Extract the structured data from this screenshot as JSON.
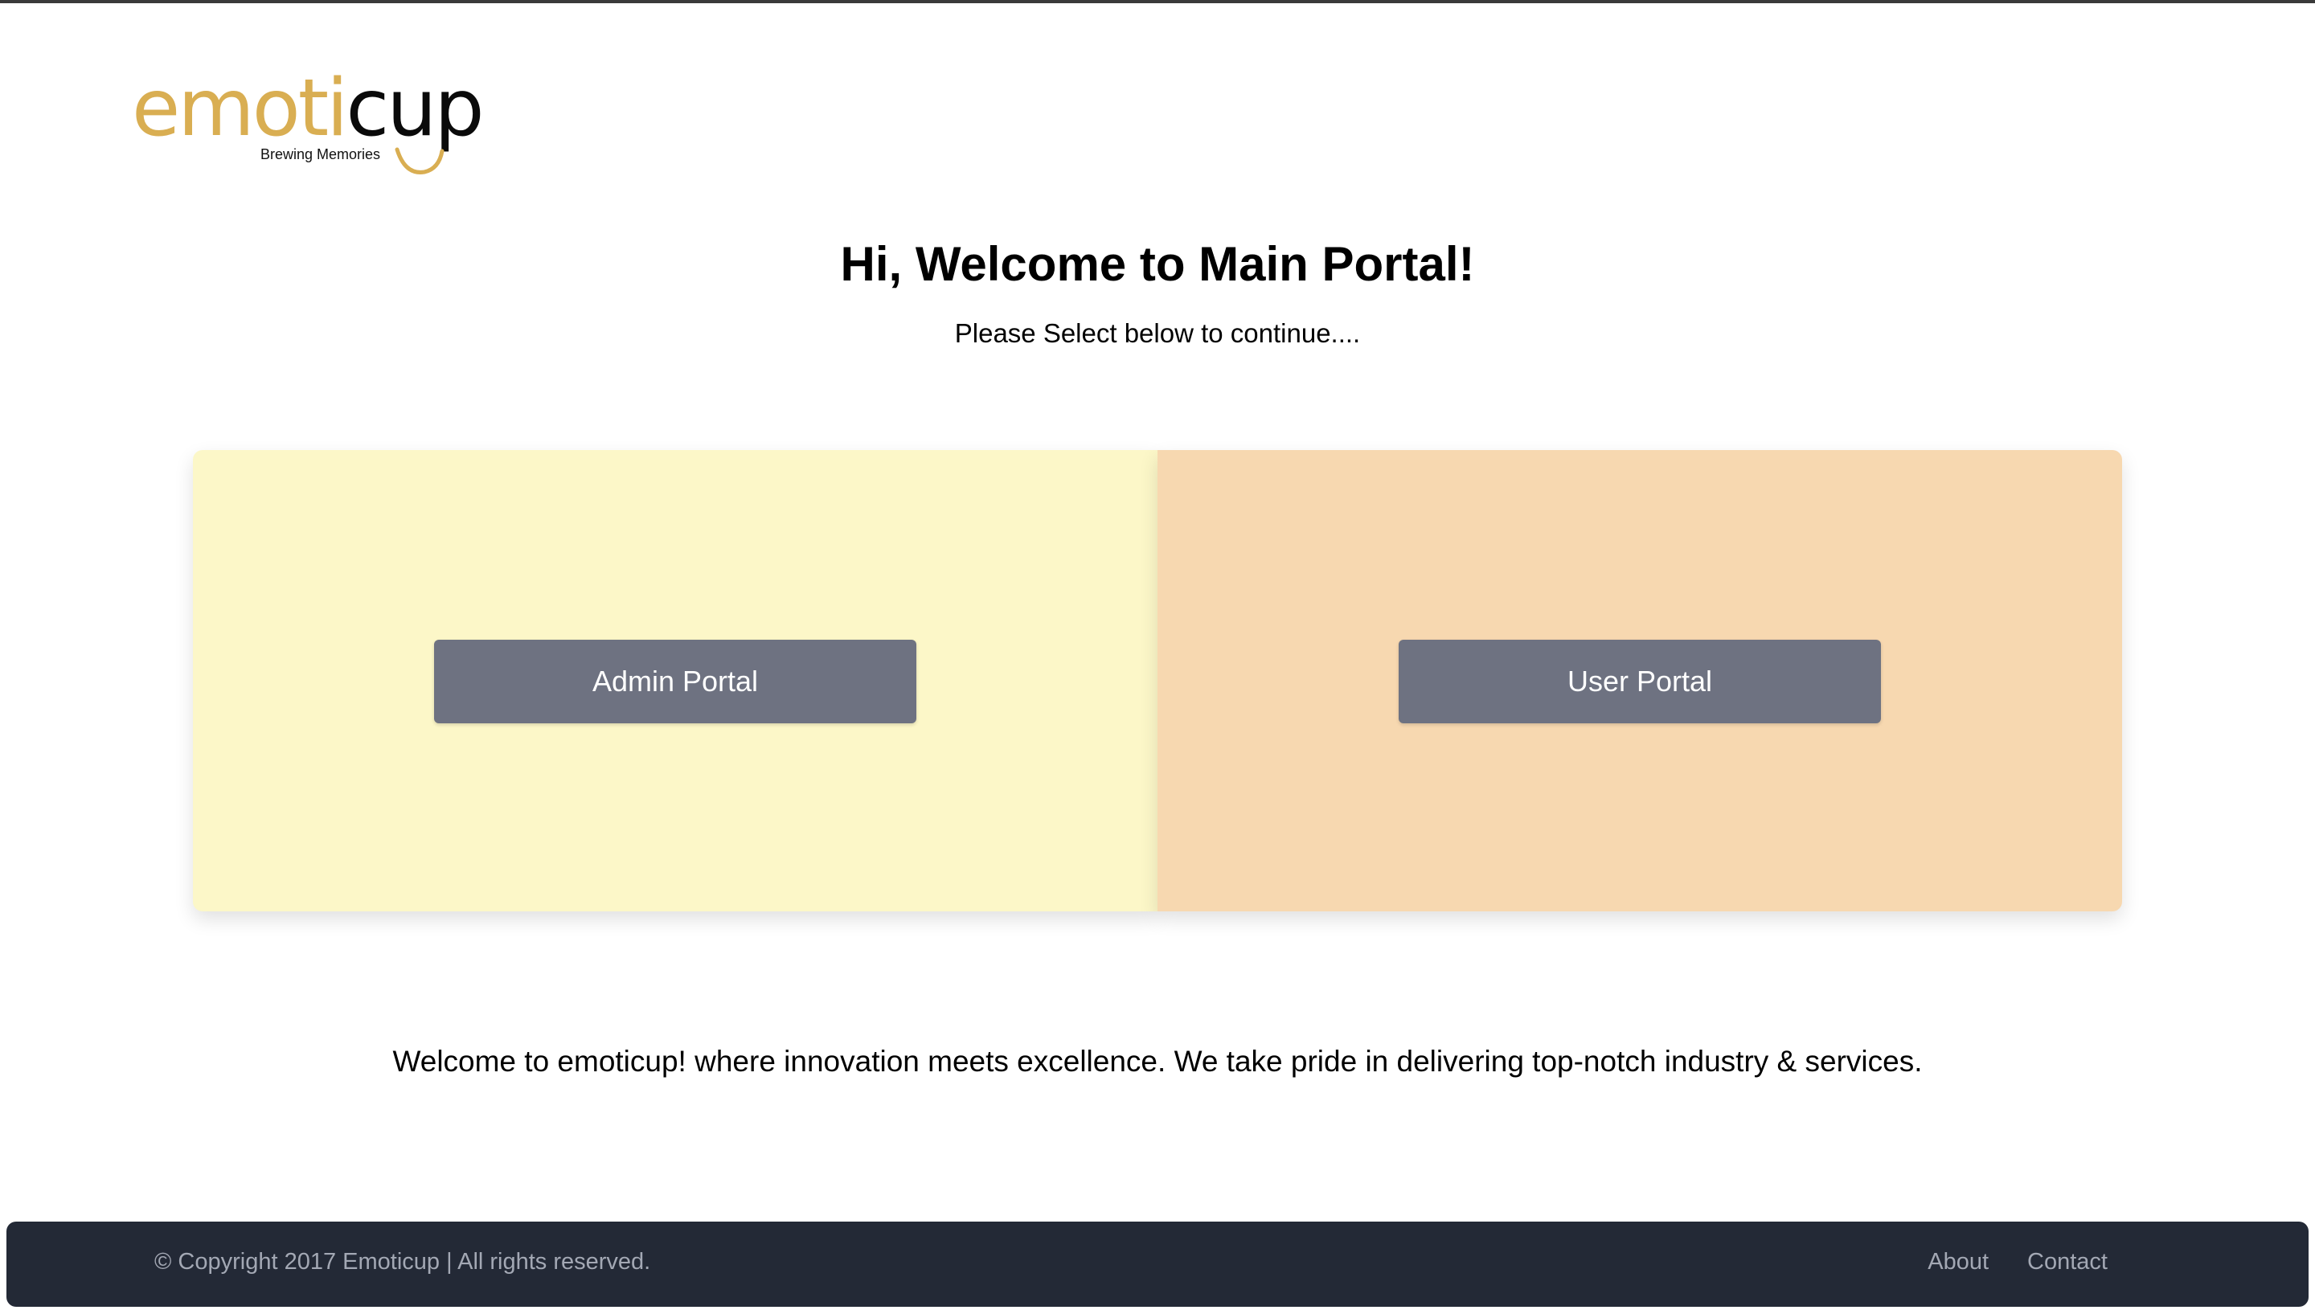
{
  "logo": {
    "brand_part1": "emoti",
    "brand_part2": "cup",
    "tagline": "Brewing Memories"
  },
  "main": {
    "title": "Hi, Welcome to Main Portal!",
    "subtitle": "Please Select below to continue....",
    "intro": "Welcome to emoticup! where innovation meets excellence. We take pride in delivering top-notch industry & services."
  },
  "portals": {
    "admin_label": "Admin Portal",
    "user_label": "User Portal"
  },
  "footer": {
    "copyright": "© Copyright 2017 Emoticup | All rights reserved.",
    "links": [
      "About",
      "Contact"
    ]
  },
  "colors": {
    "admin_panel": "#fcf7c8",
    "user_panel": "#f7d8b0",
    "button": "#6e7281",
    "footer": "#232936",
    "brand_gold": "#d9ae52"
  }
}
